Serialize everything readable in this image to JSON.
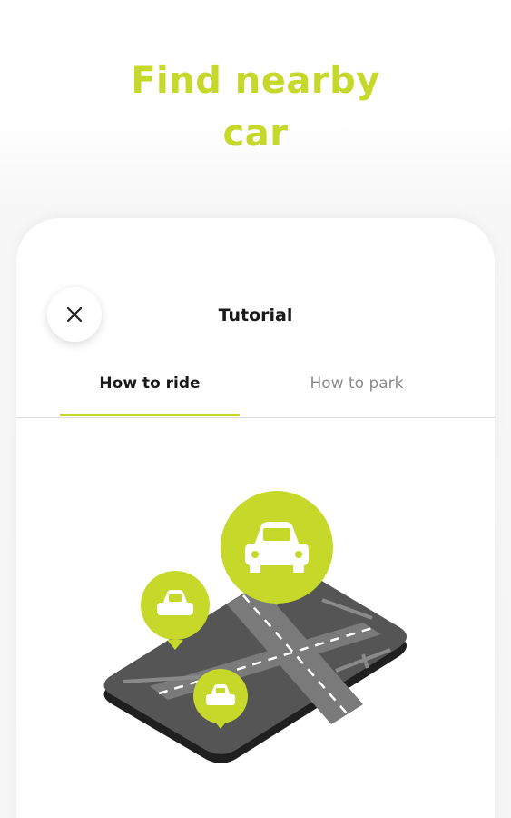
{
  "headline": {
    "line1": "Find nearby",
    "line2": "car"
  },
  "tutorial": {
    "title": "Tutorial",
    "close_icon": "close-icon",
    "tabs": [
      {
        "label": "How to ride",
        "active": true
      },
      {
        "label": "How to park",
        "active": false
      }
    ]
  },
  "colors": {
    "accent": "#c6d92b",
    "headline": "#c6d92b",
    "map_road": "#6a6a6a",
    "map_block": "#4a4a4a"
  },
  "illustration": {
    "icons": [
      "map-icon",
      "car-pin-icon"
    ]
  }
}
